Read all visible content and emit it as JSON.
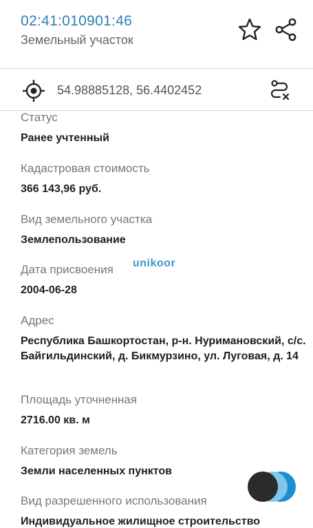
{
  "header": {
    "cadastral_number": "02:41:010901:46",
    "object_type": "Земельный участок"
  },
  "coords_bar": {
    "coordinates": "54.98885128, 56.4402452"
  },
  "watermark": {
    "brand": "unikoor"
  },
  "fields": [
    {
      "label": "Статус",
      "value": "Ранее учтенный"
    },
    {
      "label": "Кадастровая стоимость",
      "value": "366 143,96 руб."
    },
    {
      "label": "Вид земельного участка",
      "value": "Землепользование"
    },
    {
      "label": "Дата присвоения",
      "value": "2004-06-28"
    },
    {
      "label": "Адрес",
      "value": "Республика Башкортостан, р-н. Нуримановский, с/с. Байгильдинский, д. Бикмурзино, ул. Луговая, д. 14"
    },
    {
      "label": "Площадь уточненная",
      "value": "2716.00 кв. м"
    },
    {
      "label": "Категория земель",
      "value": "Земли населенных пунктов"
    },
    {
      "label": "Вид разрешенного использования",
      "value": "Индивидуальное жилищное строительство"
    }
  ],
  "icons": {
    "favorite": "star-outline-icon",
    "share": "share-icon",
    "locate": "crosshair-icon",
    "route": "route-clear-icon"
  },
  "colors": {
    "accent": "#2f7fb0",
    "fab_dark": "#2b2b2b",
    "fab_light": "#7fc6ea",
    "fab_blue": "#1a8fd1"
  }
}
